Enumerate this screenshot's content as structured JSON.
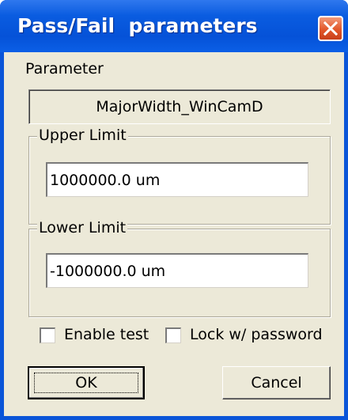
{
  "window": {
    "title": "Pass/Fail  parameters"
  },
  "parameter": {
    "label": "Parameter",
    "value": "MajorWidth_WinCamD"
  },
  "upper_limit": {
    "legend": "Upper Limit",
    "value": "1000000.0 um"
  },
  "lower_limit": {
    "legend": "Lower Limit",
    "value": "-1000000.0 um"
  },
  "options": {
    "enable_test_label": "Enable test",
    "enable_test_checked": false,
    "lock_label": "Lock w/ password",
    "lock_checked": false
  },
  "buttons": {
    "ok_label": "OK",
    "cancel_label": "Cancel"
  },
  "colors": {
    "titlebar": "#0552d8",
    "close": "#e2572a",
    "dialog_bg": "#ece9d8"
  },
  "icons": {
    "close": "close-icon"
  }
}
